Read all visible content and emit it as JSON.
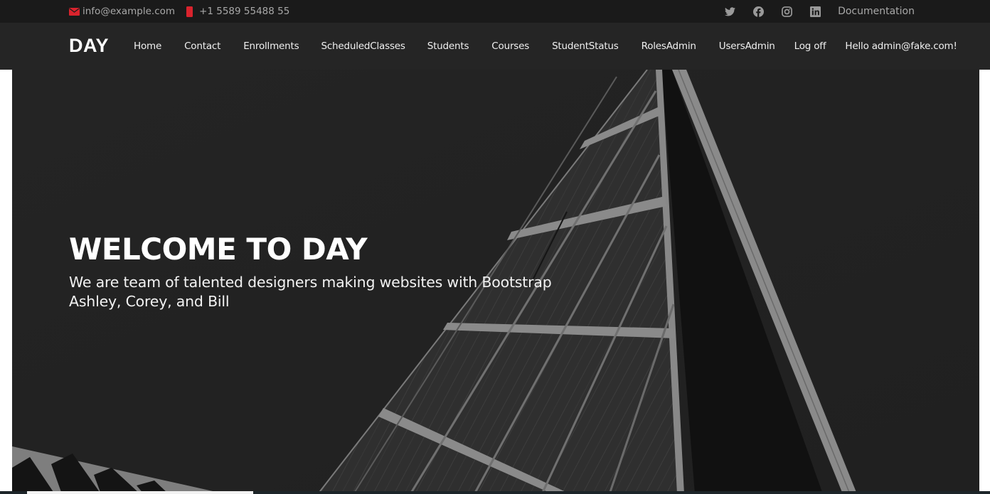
{
  "topbar": {
    "email": "info@example.com",
    "phone": "+1 5589 55488 55",
    "accent_color": "#d9232d",
    "social": [
      {
        "name": "twitter",
        "icon": "twitter-icon"
      },
      {
        "name": "facebook",
        "icon": "facebook-icon"
      },
      {
        "name": "instagram",
        "icon": "instagram-icon"
      },
      {
        "name": "linkedin",
        "icon": "linkedin-icon"
      }
    ],
    "documentation_label": "Documentation"
  },
  "navbar": {
    "logo": "DAY",
    "items": [
      {
        "label": "Home"
      },
      {
        "label": "Contact"
      },
      {
        "label": "Enrollments"
      },
      {
        "label": "ScheduledClasses"
      },
      {
        "label": "Students"
      },
      {
        "label": "Courses"
      },
      {
        "label": "StudentStatus"
      },
      {
        "label": "RolesAdmin"
      },
      {
        "label": "UsersAdmin"
      },
      {
        "label": "Log off"
      },
      {
        "label": "Hello admin@fake.com!"
      }
    ]
  },
  "hero": {
    "title": "WELCOME TO DAY",
    "subtitle_line1": "We are team of talented designers making websites with Bootstrap",
    "subtitle_line2": "Ashley, Corey, and Bill"
  }
}
